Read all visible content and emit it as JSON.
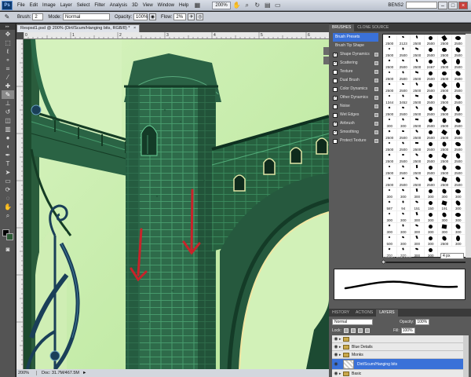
{
  "menubar": {
    "app_logo": "Ps",
    "items": [
      "File",
      "Edit",
      "Image",
      "Layer",
      "Select",
      "Filter",
      "Analysis",
      "3D",
      "View",
      "Window",
      "Help"
    ],
    "zoom": "200%",
    "workspace": "BENS2",
    "icons": [
      "hand-icon",
      "zoom-icon",
      "rotate-view-icon",
      "arrange-documents-icon",
      "screen-mode-icon"
    ]
  },
  "options_bar": {
    "brush_label": "Brush:",
    "brush_size": "2",
    "mode_label": "Mode:",
    "mode_value": "Normal",
    "opacity_label": "Opacity:",
    "opacity_value": "100%",
    "flow_label": "Flow:",
    "flow_value": "2%"
  },
  "document": {
    "tab_title": "Respsd1.psd @ 200% (Dirt/Scum/Hanging bits, RGB/8) *",
    "tab_close": "×",
    "status_zoom": "200%",
    "status_info": "Doc: 31.7M/467.5M",
    "status_arrow": "►",
    "ruler_labels": [
      "0",
      "1",
      "2",
      "3",
      "4",
      "5",
      "6"
    ]
  },
  "brushes_panel": {
    "tabs": [
      "BRUSHES",
      "CLONE SOURCE"
    ],
    "options": [
      {
        "label": "Brush Presets",
        "checked": null,
        "lock": false
      },
      {
        "label": "Brush Tip Shape",
        "checked": null,
        "lock": false
      },
      {
        "label": "Shape Dynamics",
        "checked": true,
        "lock": true
      },
      {
        "label": "Scattering",
        "checked": true,
        "lock": true
      },
      {
        "label": "Texture",
        "checked": false,
        "lock": true
      },
      {
        "label": "Dual Brush",
        "checked": false,
        "lock": true
      },
      {
        "label": "Color Dynamics",
        "checked": false,
        "lock": true
      },
      {
        "label": "Other Dynamics",
        "checked": true,
        "lock": true
      },
      {
        "label": "Noise",
        "checked": false,
        "lock": true
      },
      {
        "label": "Wet Edges",
        "checked": false,
        "lock": true
      },
      {
        "label": "Airbrush",
        "checked": true,
        "lock": true
      },
      {
        "label": "Smoothing",
        "checked": true,
        "lock": true
      },
      {
        "label": "Protect Texture",
        "checked": false,
        "lock": true
      }
    ],
    "presets": [
      "2500",
      "2123",
      "2500",
      "2500",
      "2500",
      "2500",
      "2500",
      "2500",
      "2500",
      "2500",
      "2500",
      "2500",
      "2500",
      "2500",
      "2500",
      "2467",
      "2500",
      "2500",
      "2500",
      "2500",
      "2500",
      "2500",
      "2500",
      "2500",
      "2500",
      "2500",
      "2500",
      "2500",
      "2500",
      "2500",
      "1344",
      "3452",
      "2500",
      "2500",
      "2500",
      "2500",
      "2500",
      "2500",
      "2500",
      "2500",
      "2500",
      "2500",
      "300",
      "300",
      "2500",
      "2500",
      "2500",
      "2500",
      "2500",
      "2500",
      "2500",
      "2500",
      "2500",
      "2500",
      "2500",
      "2500",
      "2500",
      "2500",
      "2500",
      "2500",
      "2500",
      "2500",
      "2500",
      "2500",
      "2500",
      "2500",
      "2500",
      "2500",
      "2500",
      "2500",
      "2500",
      "2500",
      "2500",
      "2500",
      "2500",
      "2500",
      "2500",
      "2500",
      "300",
      "300",
      "300",
      "300",
      "300",
      "300",
      "587",
      "94",
      "151",
      "150",
      "191",
      "300",
      "300",
      "300",
      "300",
      "300",
      "300",
      "300",
      "300",
      "300",
      "300",
      "300",
      "300",
      "300",
      "500",
      "300",
      "300",
      "300",
      "2500",
      "300",
      "300",
      "300",
      "300",
      "300"
    ],
    "master_diameter_label": "Master Diameter",
    "master_diameter_value": "4 px"
  },
  "layers_panel": {
    "tabs": [
      "HISTORY",
      "ACTIONS",
      "LAYERS"
    ],
    "blend_mode": "Normal",
    "opacity_label": "Opacity:",
    "opacity_value": "100%",
    "lock_label": "Lock:",
    "fill_label": "Fill:",
    "fill_value": "100%",
    "layers": [
      {
        "name": "",
        "type": "group"
      },
      {
        "name": "Blue Details",
        "type": "group"
      },
      {
        "name": "Monks",
        "type": "group"
      },
      {
        "name": "Dirt/Scum/Hanging bits",
        "type": "layer",
        "selected": true
      },
      {
        "name": "Basic",
        "type": "group"
      }
    ]
  },
  "colors": {
    "accent": "#3a71d8",
    "foreground": "#000000",
    "background": "#2c5a34",
    "canvas_light": "#cdeeb4",
    "tower_dark": "#2f6d4a",
    "arrow_red": "#c8232a"
  }
}
